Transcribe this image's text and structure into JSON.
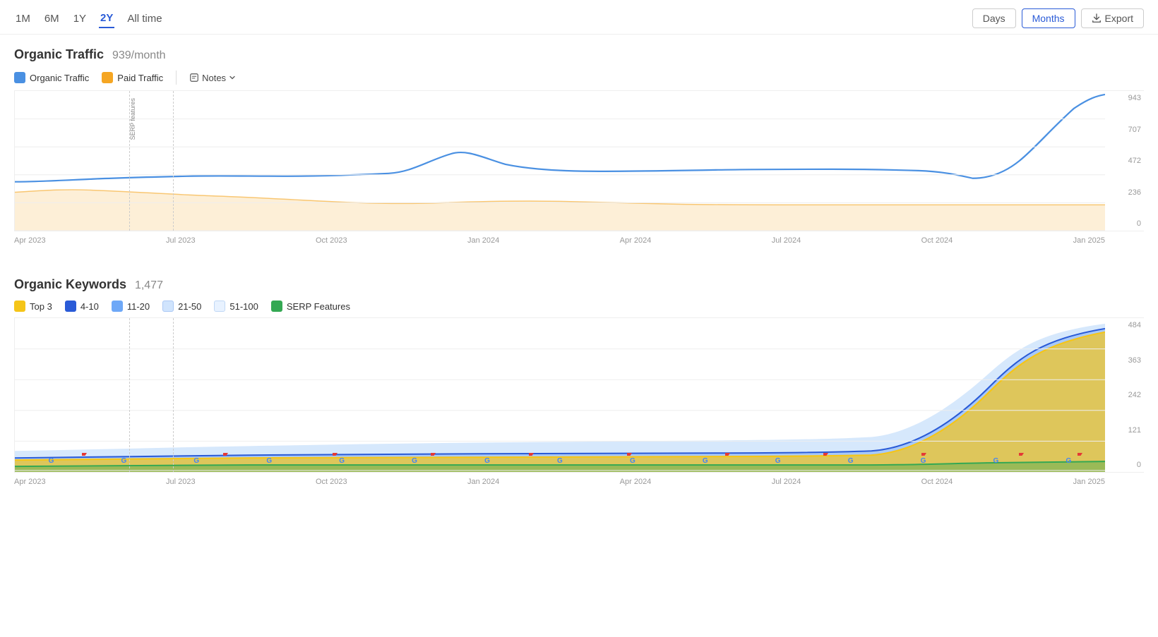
{
  "timeFilters": {
    "options": [
      "1M",
      "6M",
      "1Y",
      "2Y",
      "All time"
    ],
    "active": "2Y"
  },
  "viewControls": {
    "days_label": "Days",
    "months_label": "Months",
    "active": "Months",
    "export_label": "Export"
  },
  "organicTraffic": {
    "title": "Organic Traffic",
    "value": "939/month",
    "legend": [
      {
        "id": "organic",
        "label": "Organic Traffic",
        "color": "blue"
      },
      {
        "id": "paid",
        "label": "Paid Traffic",
        "color": "orange"
      }
    ],
    "notes_label": "Notes",
    "yAxis": [
      "943",
      "707",
      "472",
      "236",
      "0"
    ],
    "xAxis": [
      "Apr 2023",
      "Jul 2023",
      "Oct 2023",
      "Jan 2024",
      "Apr 2024",
      "Jul 2024",
      "Oct 2024",
      "Jan 2025"
    ],
    "annotation": "SERP features"
  },
  "organicKeywords": {
    "title": "Organic Keywords",
    "value": "1,477",
    "legend": [
      {
        "id": "top3",
        "label": "Top 3",
        "color": "yellow"
      },
      {
        "id": "4-10",
        "label": "4-10",
        "color": "darkblue"
      },
      {
        "id": "11-20",
        "label": "11-20",
        "color": "medblue"
      },
      {
        "id": "21-50",
        "label": "21-50",
        "color": "lightblue"
      },
      {
        "id": "51-100",
        "label": "51-100",
        "color": "verylightblue"
      },
      {
        "id": "serp",
        "label": "SERP Features",
        "color": "green"
      }
    ],
    "yAxis": [
      "484",
      "363",
      "242",
      "121",
      "0"
    ],
    "xAxis": [
      "Apr 2023",
      "Jul 2023",
      "Oct 2023",
      "Jan 2024",
      "Apr 2024",
      "Jul 2024",
      "Oct 2024",
      "Jan 2025"
    ]
  }
}
